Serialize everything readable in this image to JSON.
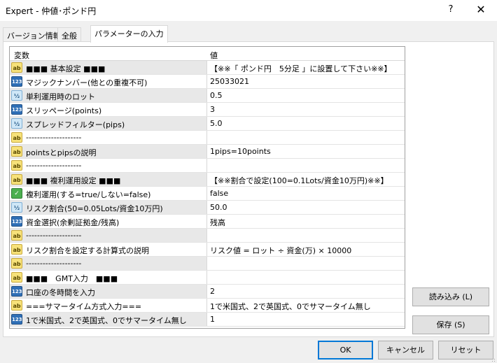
{
  "window": {
    "title": "Expert - 仲値･ポンド円",
    "help_label": "?",
    "close_label": "✕"
  },
  "tabs": [
    {
      "label": "バージョン情報"
    },
    {
      "label": "全般"
    },
    {
      "label": "パラメーターの入力"
    }
  ],
  "grid": {
    "col_variable": "変数",
    "col_value": "値",
    "rows": [
      {
        "icon": "ab",
        "name": "■■■ 基本設定 ■■■",
        "value": "【※※「 ポンド円　5分足 」に設置して下さい※※】"
      },
      {
        "icon": "123",
        "name": "マジックナンバー(他との重複不可)",
        "value": "25033021"
      },
      {
        "icon": "v2",
        "name": "単利運用時のロット",
        "value": "0.5"
      },
      {
        "icon": "123",
        "name": "スリッページ(points)",
        "value": "3"
      },
      {
        "icon": "v2",
        "name": "スプレッドフィルター(pips)",
        "value": "5.0"
      },
      {
        "icon": "ab",
        "name": "--------------------",
        "value": ""
      },
      {
        "icon": "ab",
        "name": "pointsとpipsの説明",
        "value": "1pips=10points"
      },
      {
        "icon": "ab",
        "name": "--------------------",
        "value": ""
      },
      {
        "icon": "ab",
        "name": "■■■ 複利運用設定 ■■■",
        "value": "【※※割合で設定(100=0.1Lots/資金10万円)※※】"
      },
      {
        "icon": "bool",
        "name": "複利運用(する=true/しない=false)",
        "value": "false"
      },
      {
        "icon": "v2",
        "name": "リスク割合(50=0.05Lots/資金10万円)",
        "value": "50.0"
      },
      {
        "icon": "123",
        "name": "資金選択(余剰証拠金/残高)",
        "value": "残高"
      },
      {
        "icon": "ab",
        "name": "--------------------",
        "value": ""
      },
      {
        "icon": "ab",
        "name": "リスク割合を設定する計算式の説明",
        "value": "リスク値 = ロット ÷ 資金(万) × 10000"
      },
      {
        "icon": "ab",
        "name": "--------------------",
        "value": ""
      },
      {
        "icon": "ab",
        "name": "■■■　GMT入力　■■■",
        "value": ""
      },
      {
        "icon": "123",
        "name": "口座の冬時間を入力",
        "value": "2"
      },
      {
        "icon": "ab",
        "name": "===サマータイム方式入力===",
        "value": "1で米国式、2で英国式、0でサマータイム無し"
      },
      {
        "icon": "123",
        "name": "1で米国式、2で英国式、0でサマータイム無し",
        "value": "1"
      }
    ]
  },
  "buttons": {
    "load": "読み込み (L)",
    "save": "保存 (S)",
    "ok": "OK",
    "cancel": "キャンセル",
    "reset": "リセット"
  },
  "icon_names": {
    "ab": "string-type-icon",
    "123": "integer-type-icon",
    "v2": "double-type-icon",
    "bool": "bool-type-icon"
  }
}
